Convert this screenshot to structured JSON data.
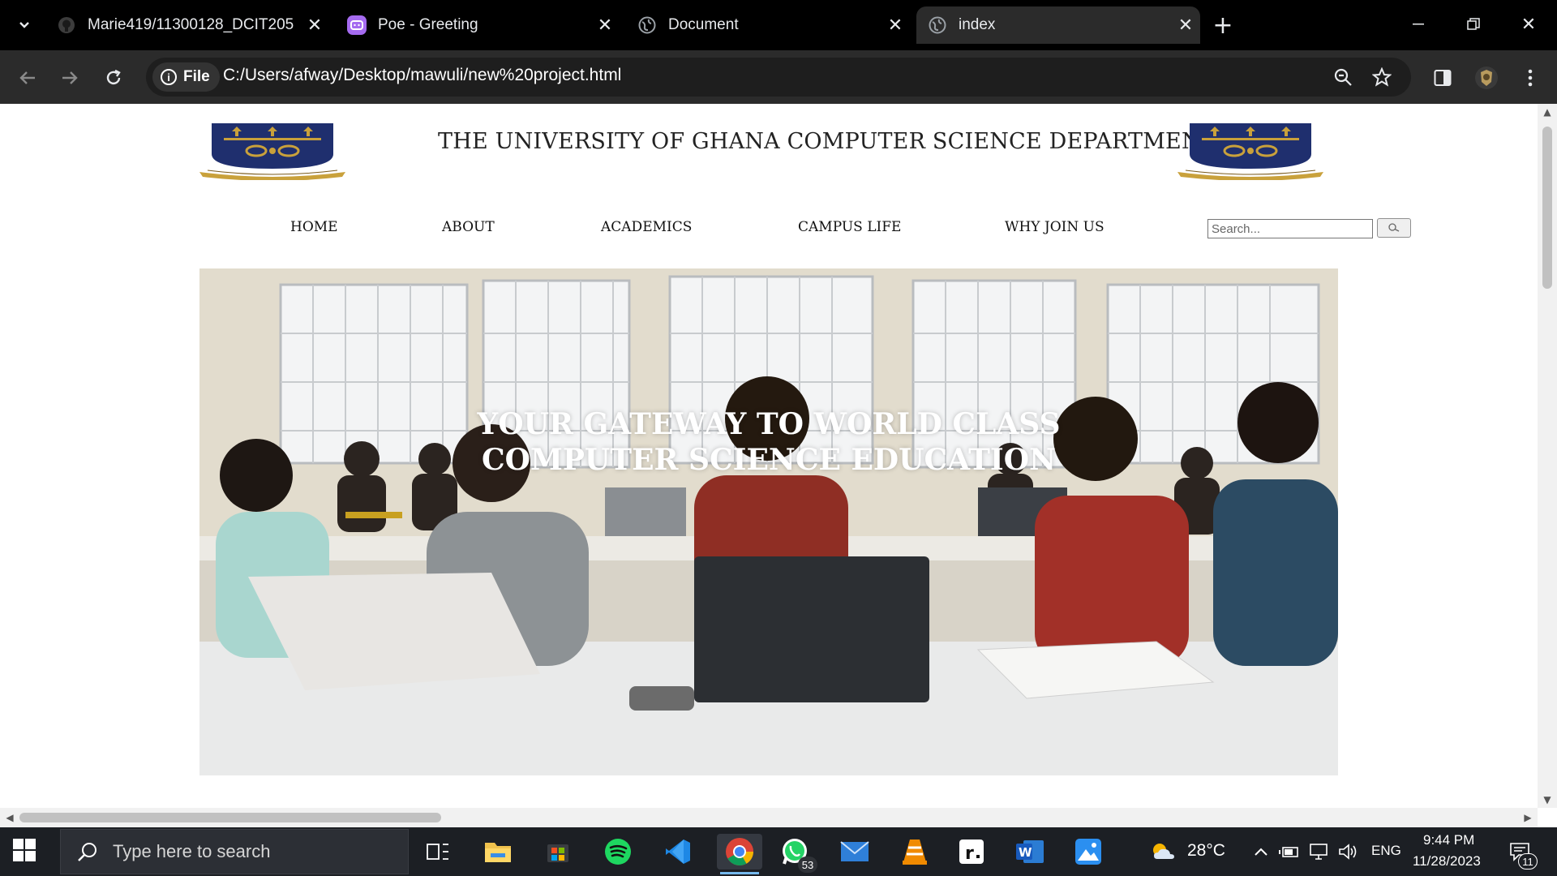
{
  "browser": {
    "tabs": [
      {
        "title": "Marie419/11300128_DCIT205",
        "icon": "github-icon"
      },
      {
        "title": "Poe - Greeting",
        "icon": "poe-icon"
      },
      {
        "title": "Document",
        "icon": "globe-icon"
      },
      {
        "title": "index",
        "icon": "globe-icon",
        "active": true
      }
    ],
    "address": {
      "chip_label": "File",
      "url": "C:/Users/afway/Desktop/mawuli/new%20project.html"
    }
  },
  "page": {
    "title": "THE UNIVERSITY OF GHANA COMPUTER SCIENCE DEPARTMENT",
    "nav": {
      "home": "HOME",
      "about": "ABOUT",
      "academics": "ACADEMICS",
      "campus_life": "CAMPUS LIFE",
      "why_join": "WHY JOIN US"
    },
    "search": {
      "placeholder": "Search..."
    },
    "hero": {
      "line1": "YOUR GATEWAY TO WORLD CLASS",
      "line2": "COMPUTER SCIENCE EDUCATION"
    }
  },
  "taskbar": {
    "search_placeholder": "Type here to search",
    "whatsapp_badge": "53",
    "weather": "28°C",
    "language": "ENG",
    "time": "9:44 PM",
    "date": "11/28/2023",
    "notifications": "11"
  },
  "colors": {
    "brand_navy": "#1f2f6e",
    "brand_gold": "#c9a13b",
    "taskbar_bg": "#1c1f24",
    "chrome_toolbar": "#2b2b2b"
  }
}
